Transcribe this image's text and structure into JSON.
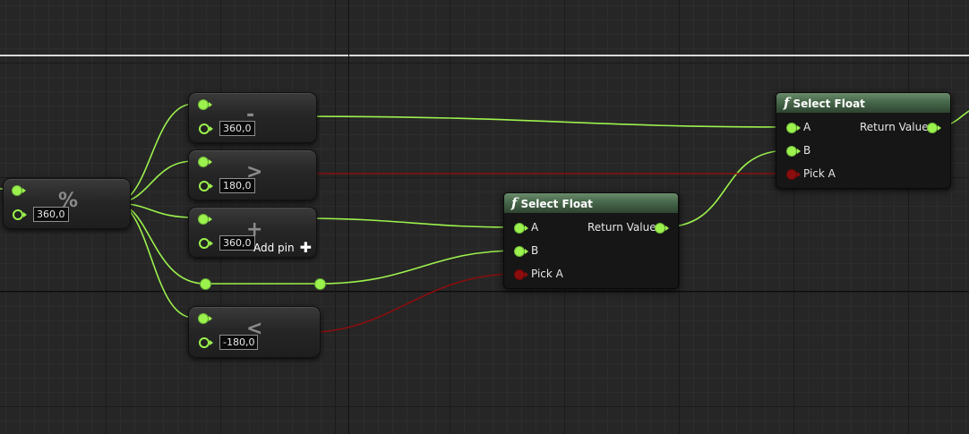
{
  "graph": {
    "modulo_node": {
      "symbol": "%",
      "value": "360,0"
    },
    "subtract_node": {
      "symbol": "-",
      "value": "360,0"
    },
    "greater_node": {
      "symbol": ">",
      "value": "180,0"
    },
    "add_node": {
      "symbol": "+",
      "value": "360,0",
      "add_pin_label": "Add pin",
      "add_pin_icon": "plus-icon"
    },
    "less_node": {
      "symbol": "<",
      "value": "-180,0"
    },
    "select_float_1": {
      "title": "Select Float",
      "icon": "function-icon",
      "pin_a": "A",
      "pin_b": "B",
      "pin_pick": "Pick A",
      "output": "Return Value"
    },
    "select_float_2": {
      "title": "Select Float",
      "icon": "function-icon",
      "pin_a": "A",
      "pin_b": "B",
      "pin_pick": "Pick A",
      "output": "Return Value"
    }
  },
  "colors": {
    "float_wire": "#9cf24d",
    "bool_wire": "#8c0d0d",
    "function_header": "#4a6b4d",
    "grid_background": "#262626"
  }
}
